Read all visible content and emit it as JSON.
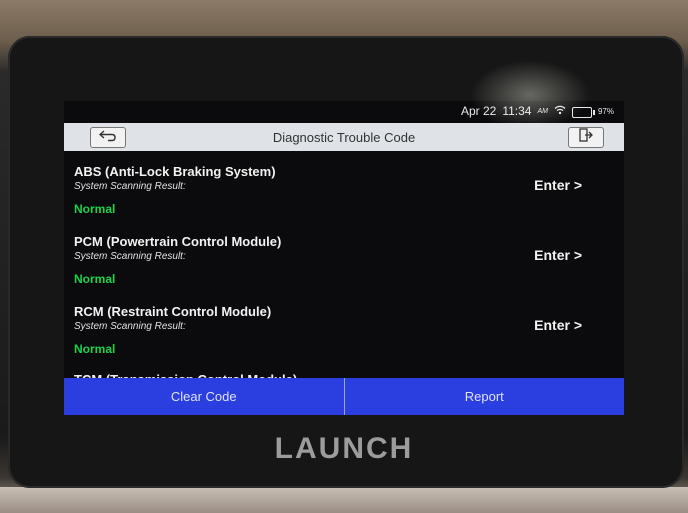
{
  "status": {
    "date": "Apr 22",
    "time": "11:34",
    "ampm": "AM",
    "battery": "97%"
  },
  "header": {
    "title": "Diagnostic Trouble Code"
  },
  "systems": [
    {
      "name": "ABS (Anti-Lock Braking System)",
      "subtitle": "System Scanning Result:",
      "status": "Normal",
      "action": "Enter >"
    },
    {
      "name": "PCM (Powertrain Control Module)",
      "subtitle": "System Scanning Result:",
      "status": "Normal",
      "action": "Enter >"
    },
    {
      "name": "RCM (Restraint Control Module)",
      "subtitle": "System Scanning Result:",
      "status": "Normal",
      "action": "Enter >"
    },
    {
      "name": "TCM (Transmission Control Module)"
    }
  ],
  "actions": {
    "clear": "Clear Code",
    "report": "Report"
  },
  "brand": "LAUNCH",
  "colors": {
    "accent": "#2b3ee0",
    "ok": "#19d24a",
    "titlebar": "#dfe3e8"
  }
}
